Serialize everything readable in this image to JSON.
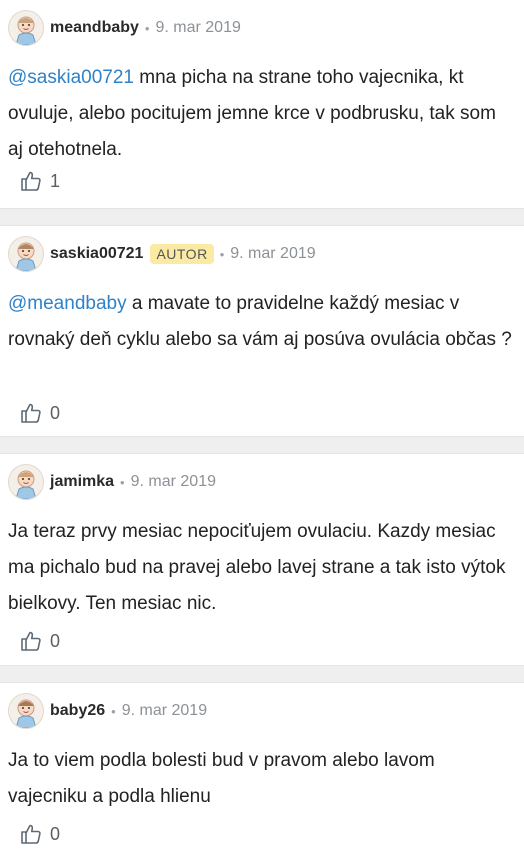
{
  "comments": [
    {
      "username": "meandbaby",
      "badge": "",
      "separator": "•",
      "date": "9. mar 2019",
      "mention": "@saskia00721",
      "text": " mna picha na strane toho vajecnika, kt ovuluje, alebo pocitujem jemne krce v podbrusku, tak som aj otehotnela.",
      "likes": "1",
      "avatar_icon": "baby-avatar-icon"
    },
    {
      "username": "saskia00721",
      "badge": "AUTOR",
      "separator": "•",
      "date": "9. mar 2019",
      "mention": "@meandbaby",
      "text": " a mavate to pravidelne každý mesiac v rovnaký deň cyklu alebo sa vám aj posúva ovulácia občas ?",
      "likes": "0",
      "avatar_icon": "baby-avatar-icon"
    },
    {
      "username": "jamimka",
      "badge": "",
      "separator": "•",
      "date": "9. mar 2019",
      "mention": "",
      "text": "Ja teraz prvy mesiac nepociťujem ovulaciu. Kazdy mesiac ma pichalo bud na pravej alebo lavej strane a tak isto výtok bielkovy. Ten mesiac nic.",
      "likes": "0",
      "avatar_icon": "baby-avatar-icon"
    },
    {
      "username": "baby26",
      "badge": "",
      "separator": "•",
      "date": "9. mar 2019",
      "mention": "",
      "text": "Ja to viem podla bolesti bud v pravom alebo lavom vajecniku a podla hlienu",
      "likes": "0",
      "avatar_icon": "baby-avatar-icon"
    }
  ],
  "like_icon": "thumbs-up-icon",
  "colors": {
    "mention": "#2f82c8",
    "badge_bg": "#fbeaa4",
    "divider": "#efefef",
    "meta": "#8c9197"
  }
}
